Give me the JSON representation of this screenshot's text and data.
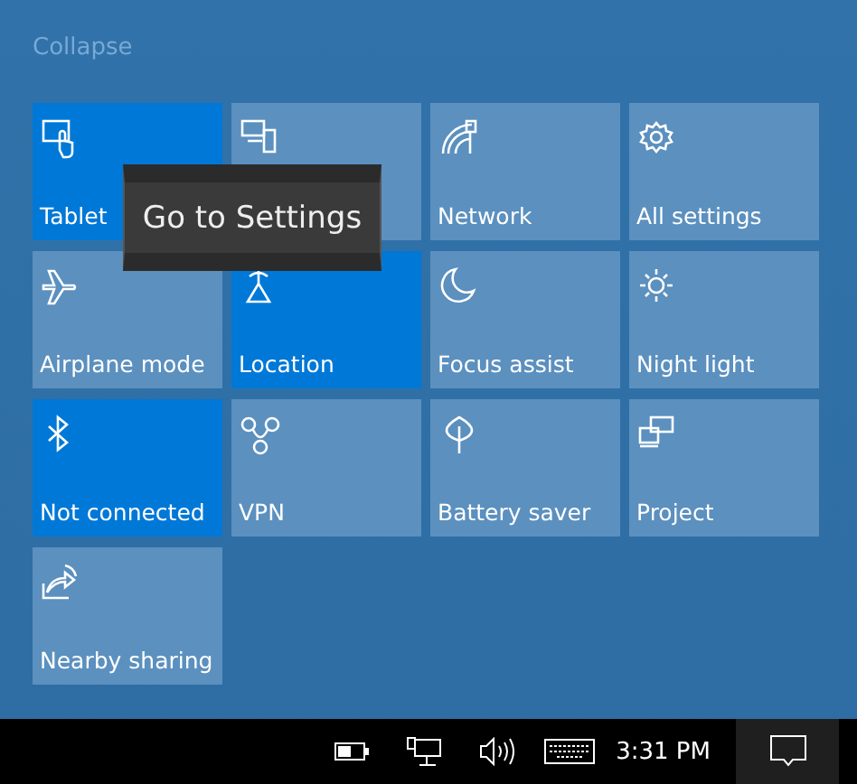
{
  "collapse_link": "Collapse",
  "tiles": [
    {
      "label": "Tablet",
      "on": true
    },
    {
      "on": false
    },
    {
      "label": "Network",
      "on": false
    },
    {
      "label": "All settings",
      "on": false
    },
    {
      "label": "Airplane mode",
      "on": false
    },
    {
      "label": "Location",
      "on": true
    },
    {
      "label": "Focus assist",
      "on": false
    },
    {
      "label": "Night light",
      "on": false
    },
    {
      "label": "Not connected",
      "on": true
    },
    {
      "label": "VPN",
      "on": false
    },
    {
      "label": "Battery saver",
      "on": false
    },
    {
      "label": "Project",
      "on": false
    },
    {
      "label": "Nearby sharing",
      "on": false
    }
  ],
  "tooltip": "Go to Settings",
  "taskbar": {
    "clock": "3:31 PM"
  }
}
